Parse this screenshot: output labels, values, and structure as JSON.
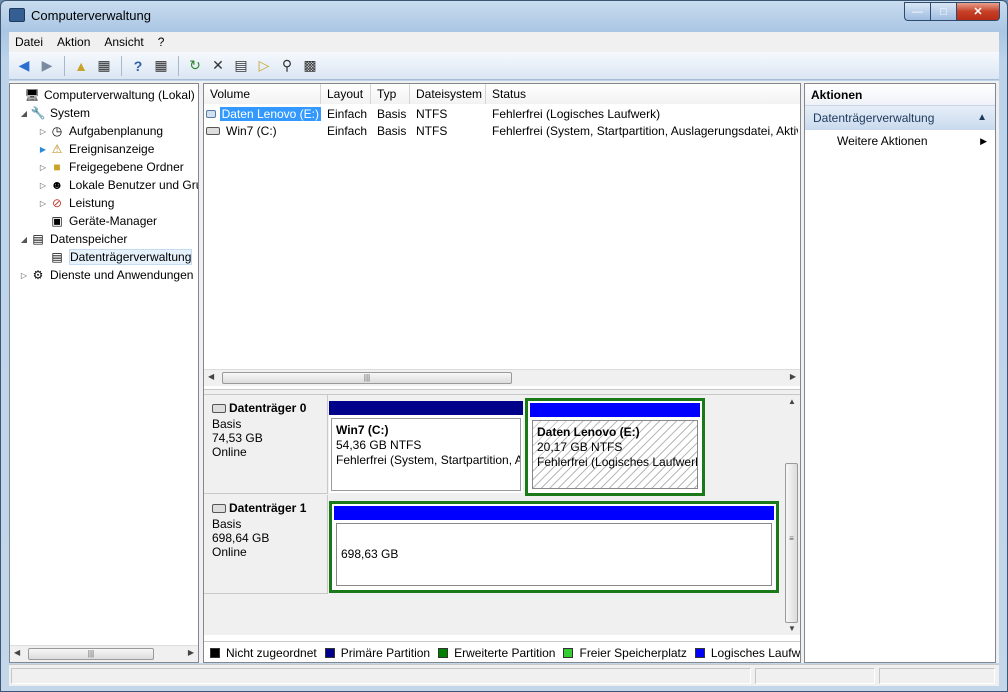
{
  "window": {
    "title": "Computerverwaltung"
  },
  "menu": [
    "Datei",
    "Aktion",
    "Ansicht",
    "?"
  ],
  "tree": {
    "items": [
      {
        "label": "Computerverwaltung (Lokal)",
        "icon": "computer-icon"
      },
      {
        "label": "System",
        "icon": "tools-icon"
      },
      {
        "label": "Aufgabenplanung",
        "icon": "clock-icon"
      },
      {
        "label": "Ereignisanzeige",
        "icon": "event-viewer-icon"
      },
      {
        "label": "Freigegebene Ordner",
        "icon": "shared-folder-icon"
      },
      {
        "label": "Lokale Benutzer und Gru",
        "icon": "users-icon"
      },
      {
        "label": "Leistung",
        "icon": "performance-icon"
      },
      {
        "label": "Geräte-Manager",
        "icon": "device-manager-icon"
      },
      {
        "label": "Datenspeicher",
        "icon": "storage-icon"
      },
      {
        "label": "Datenträgerverwaltung",
        "icon": "disk-management-icon"
      },
      {
        "label": "Dienste und Anwendungen",
        "icon": "services-icon"
      }
    ]
  },
  "volumes": {
    "columns": [
      "Volume",
      "Layout",
      "Typ",
      "Dateisystem",
      "Status"
    ],
    "rows": [
      {
        "volume": "Daten Lenovo (E:)",
        "layout": "Einfach",
        "typ": "Basis",
        "fs": "NTFS",
        "status": "Fehlerfrei (Logisches Laufwerk)"
      },
      {
        "volume": "Win7  (C:)",
        "layout": "Einfach",
        "typ": "Basis",
        "fs": "NTFS",
        "status": "Fehlerfrei (System, Startpartition, Auslagerungsdatei, Aktiv"
      }
    ]
  },
  "disks": [
    {
      "name": "Datenträger 0",
      "type": "Basis",
      "size": "74,53 GB",
      "state": "Online"
    },
    {
      "name": "Datenträger 1",
      "type": "Basis",
      "size": "698,64 GB",
      "state": "Online"
    }
  ],
  "partitions": {
    "win7": {
      "name": "Win7  (C:)",
      "size": "54,36 GB NTFS",
      "status": "Fehlerfrei (System, Startpartition, A"
    },
    "daten": {
      "name": "Daten Lenovo  (E:)",
      "size": "20,17 GB NTFS",
      "status": "Fehlerfrei (Logisches Laufwerk"
    },
    "disk1": {
      "size": "698,63 GB"
    }
  },
  "legend": [
    {
      "label": "Nicht zugeordnet",
      "color": "#000000"
    },
    {
      "label": "Primäre Partition",
      "color": "#00008b"
    },
    {
      "label": "Erweiterte Partition",
      "color": "#008000"
    },
    {
      "label": "Freier Speicherplatz",
      "color": "#33cc33"
    },
    {
      "label": "Logisches Laufwerk",
      "color": "#0000ff"
    }
  ],
  "actions": {
    "title": "Aktionen",
    "section": "Datenträgerverwaltung",
    "item": "Weitere Aktionen"
  }
}
